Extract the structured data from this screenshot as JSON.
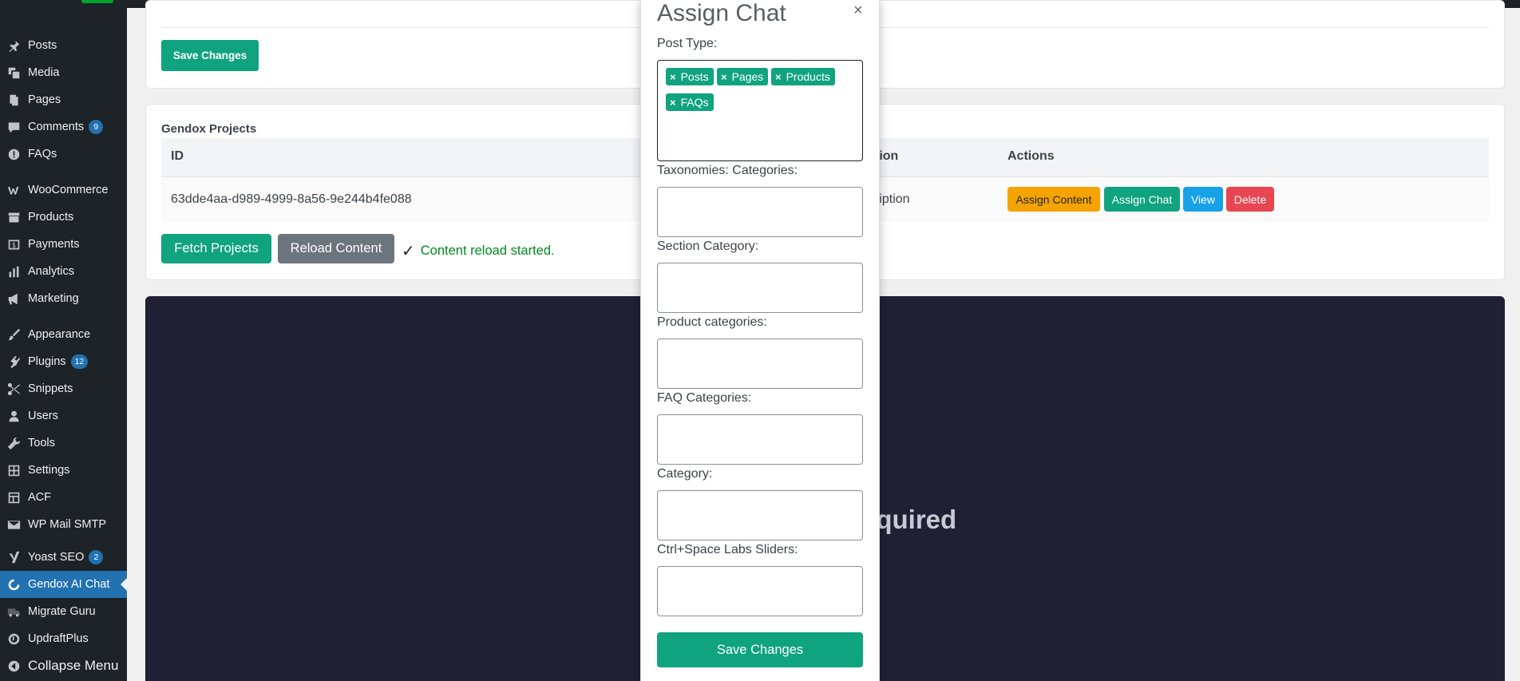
{
  "sidebar": {
    "items": [
      {
        "label": "Posts",
        "icon": "pin-icon"
      },
      {
        "label": "Media",
        "icon": "media-icon"
      },
      {
        "label": "Pages",
        "icon": "pages-icon"
      },
      {
        "label": "Comments",
        "icon": "comment-icon",
        "badge": "9"
      },
      {
        "label": "FAQs",
        "icon": "info-icon"
      },
      {
        "label": "WooCommerce",
        "icon": "woocommerce-icon"
      },
      {
        "label": "Products",
        "icon": "archive-icon"
      },
      {
        "label": "Payments",
        "icon": "dollar-icon"
      },
      {
        "label": "Analytics",
        "icon": "bar-chart-icon"
      },
      {
        "label": "Marketing",
        "icon": "megaphone-icon"
      },
      {
        "label": "Appearance",
        "icon": "brush-icon"
      },
      {
        "label": "Plugins",
        "icon": "plugin-icon",
        "badge": "12"
      },
      {
        "label": "Snippets",
        "icon": "scissors-icon"
      },
      {
        "label": "Users",
        "icon": "user-icon"
      },
      {
        "label": "Tools",
        "icon": "wrench-icon"
      },
      {
        "label": "Settings",
        "icon": "settings-icon"
      },
      {
        "label": "ACF",
        "icon": "grid-icon"
      },
      {
        "label": "WP Mail SMTP",
        "icon": "mail-icon"
      },
      {
        "label": "Yoast SEO",
        "icon": "yoast-icon",
        "badge": "2"
      },
      {
        "label": "Gendox AI Chat",
        "icon": "gendox-icon"
      },
      {
        "label": "Migrate Guru",
        "icon": "truck-icon"
      },
      {
        "label": "UpdraftPlus",
        "icon": "updraft-icon"
      },
      {
        "label": "Collapse Menu",
        "icon": "collapse-icon"
      }
    ]
  },
  "top_panel": {
    "save_label": "Save Changes"
  },
  "projects": {
    "title": "Gendox Projects",
    "headers": {
      "id": "ID",
      "description": "tion",
      "actions": "Actions"
    },
    "row": {
      "id": "63dde4aa-d989-4999-8a56-9e244b4fe088",
      "description": "ription",
      "actions": {
        "assign_content": "Assign Content",
        "assign_chat": "Assign Chat",
        "view": "View",
        "delete": "Delete"
      }
    },
    "fetch_label": "Fetch Projects",
    "reload_label": "Reload Content",
    "status_text": "Content reload started."
  },
  "dark_panel": {
    "text": "equired"
  },
  "modal": {
    "title": "Assign Chat",
    "close": "×",
    "post_type_label": "Post Type:",
    "post_types": [
      "Posts",
      "Pages",
      "Products",
      "FAQs"
    ],
    "taxonomies_label": "Taxonomies: Categories:",
    "section_category_label": "Section Category:",
    "product_categories_label": "Product categories:",
    "faq_categories_label": "FAQ Categories:",
    "category_label": "Category:",
    "sliders_label": "Ctrl+Space Labs Sliders:",
    "save_label": "Save Changes"
  },
  "colors": {
    "accent_green": "#10a37f",
    "sidebar_bg": "#1d2327",
    "active_blue": "#2271b1",
    "status_green": "#008a20"
  }
}
